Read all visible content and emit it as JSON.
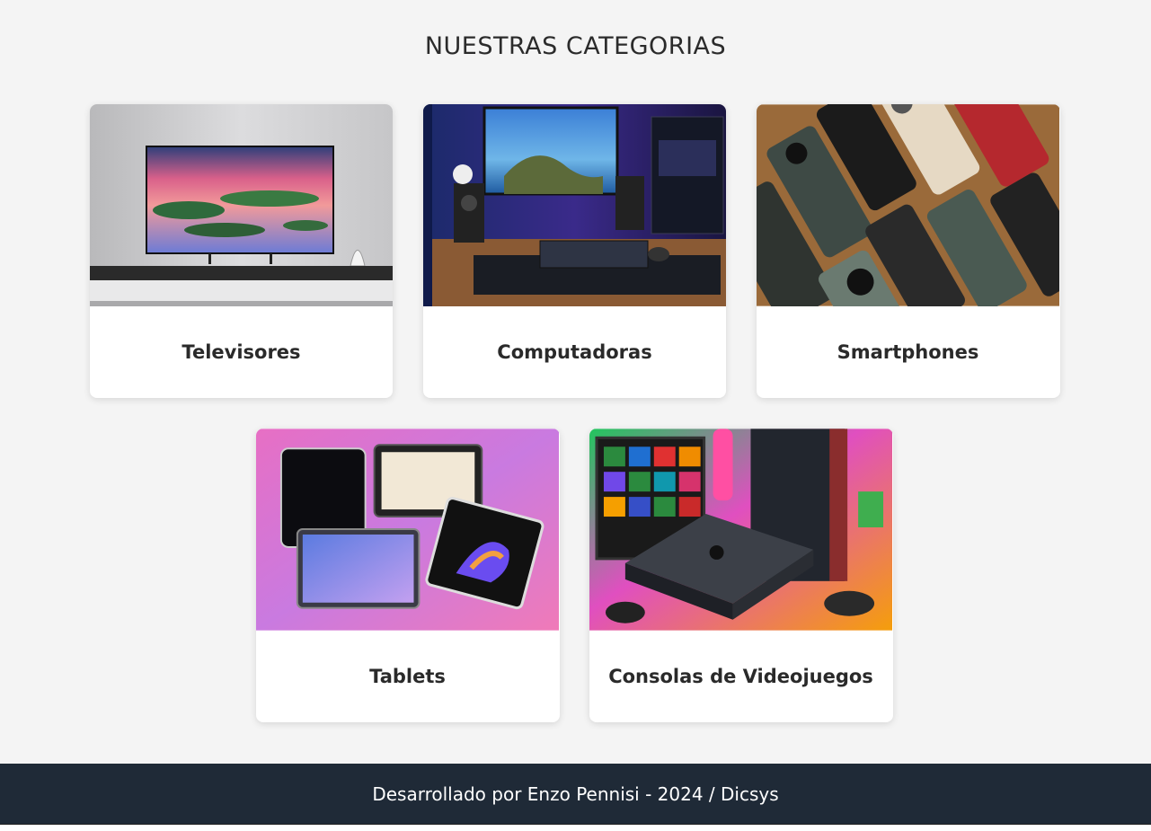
{
  "page": {
    "title": "NUESTRAS CATEGORIAS"
  },
  "categories": [
    {
      "label": "Televisores",
      "image": "tv-photo"
    },
    {
      "label": "Computadoras",
      "image": "desk-setup-photo"
    },
    {
      "label": "Smartphones",
      "image": "phones-photo"
    },
    {
      "label": "Tablets",
      "image": "tablets-photo"
    },
    {
      "label": "Consolas de Videojuegos",
      "image": "consoles-photo"
    }
  ],
  "footer": {
    "text": "Desarrollado por Enzo Pennisi - 2024 / Dicsys"
  },
  "colors": {
    "background": "#f4f4f4",
    "card": "#ffffff",
    "footer": "#1f2a37"
  }
}
